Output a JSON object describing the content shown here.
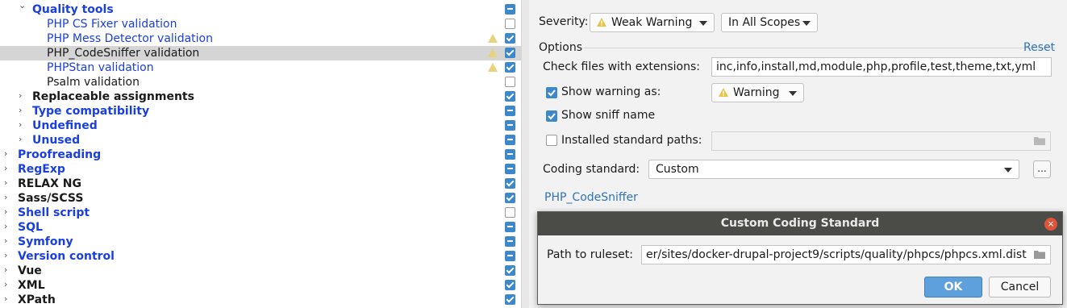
{
  "tree": {
    "items": [
      {
        "label": "Quality tools",
        "indent": 1,
        "expanded": true,
        "bold": true,
        "color": "blue",
        "check": "mixed",
        "warn": false,
        "selected": false
      },
      {
        "label": "PHP CS Fixer validation",
        "indent": 2,
        "leaf": true,
        "bold": false,
        "color": "blue",
        "check": "off",
        "warn": false,
        "selected": false
      },
      {
        "label": "PHP Mess Detector validation",
        "indent": 2,
        "leaf": true,
        "bold": false,
        "color": "blue",
        "check": "on",
        "warn": true,
        "selected": false
      },
      {
        "label": "PHP_CodeSniffer validation",
        "indent": 2,
        "leaf": true,
        "bold": false,
        "color": "black",
        "check": "on",
        "warn": true,
        "selected": true
      },
      {
        "label": "PHPStan validation",
        "indent": 2,
        "leaf": true,
        "bold": false,
        "color": "blue",
        "check": "on",
        "warn": true,
        "selected": false
      },
      {
        "label": "Psalm validation",
        "indent": 2,
        "leaf": true,
        "bold": false,
        "color": "black",
        "check": "off",
        "warn": false,
        "selected": false
      },
      {
        "label": "Replaceable assignments",
        "indent": 1,
        "expanded": false,
        "bold": true,
        "color": "black",
        "check": "on",
        "warn": false,
        "selected": false
      },
      {
        "label": "Type compatibility",
        "indent": 1,
        "expanded": false,
        "bold": true,
        "color": "blue",
        "check": "mixed",
        "warn": false,
        "selected": false
      },
      {
        "label": "Undefined",
        "indent": 1,
        "expanded": false,
        "bold": true,
        "color": "blue",
        "check": "mixed",
        "warn": false,
        "selected": false
      },
      {
        "label": "Unused",
        "indent": 1,
        "expanded": false,
        "bold": true,
        "color": "blue",
        "check": "mixed",
        "warn": false,
        "selected": false
      },
      {
        "label": "Proofreading",
        "indent": 0,
        "expanded": false,
        "bold": true,
        "color": "blue",
        "check": "mixed",
        "warn": false,
        "selected": false
      },
      {
        "label": "RegExp",
        "indent": 0,
        "expanded": false,
        "bold": true,
        "color": "blue",
        "check": "mixed",
        "warn": false,
        "selected": false
      },
      {
        "label": "RELAX NG",
        "indent": 0,
        "expanded": false,
        "bold": true,
        "color": "black",
        "check": "on",
        "warn": false,
        "selected": false
      },
      {
        "label": "Sass/SCSS",
        "indent": 0,
        "expanded": false,
        "bold": true,
        "color": "black",
        "check": "on",
        "warn": false,
        "selected": false
      },
      {
        "label": "Shell script",
        "indent": 0,
        "expanded": false,
        "bold": true,
        "color": "blue",
        "check": "off",
        "warn": false,
        "selected": false
      },
      {
        "label": "SQL",
        "indent": 0,
        "expanded": false,
        "bold": true,
        "color": "blue",
        "check": "mixed",
        "warn": false,
        "selected": false
      },
      {
        "label": "Symfony",
        "indent": 0,
        "expanded": false,
        "bold": true,
        "color": "blue",
        "check": "mixed",
        "warn": false,
        "selected": false
      },
      {
        "label": "Version control",
        "indent": 0,
        "expanded": false,
        "bold": true,
        "color": "blue",
        "check": "mixed",
        "warn": false,
        "selected": false
      },
      {
        "label": "Vue",
        "indent": 0,
        "expanded": false,
        "bold": true,
        "color": "black",
        "check": "on",
        "warn": false,
        "selected": false
      },
      {
        "label": "XML",
        "indent": 0,
        "expanded": false,
        "bold": true,
        "color": "black",
        "check": "on",
        "warn": false,
        "selected": false
      },
      {
        "label": "XPath",
        "indent": 0,
        "expanded": false,
        "bold": true,
        "color": "black",
        "check": "on",
        "warn": false,
        "selected": false
      }
    ]
  },
  "settings": {
    "severity_label": "Severity:",
    "severity_value": "Weak Warning",
    "scope_value": "In All Scopes",
    "options_label": "Options",
    "reset_label": "Reset",
    "check_ext_label": "Check files with extensions:",
    "check_ext_value": "inc,info,install,md,module,php,profile,test,theme,txt,yml",
    "show_warning_label": "Show warning as:",
    "show_warning_value": "Warning",
    "show_sniff_label": "Show sniff name",
    "installed_paths_label": "Installed standard paths:",
    "installed_paths_value": "",
    "coding_standard_label": "Coding standard:",
    "coding_standard_value": "Custom",
    "more_button_label": "...",
    "link_label": "PHP_CodeSniffer"
  },
  "dialog": {
    "title": "Custom Coding Standard",
    "close_label": "×",
    "path_label": "Path to ruleset:",
    "path_value": "er/sites/docker-drupal-project9/scripts/quality/phpcs/phpcs.xml.dist",
    "ok_label": "OK",
    "cancel_label": "Cancel"
  },
  "colors": {
    "accent": "#3d88c8",
    "link": "#2f73b8",
    "tree_blue": "#1a3fe0",
    "warning_icon": "#e8c34a",
    "dialog_title_bg": "#4b4b47",
    "close_button": "#e0543a",
    "ok_button": "#5ea0dc"
  },
  "icons": {
    "expanded": "chevron-down-icon",
    "collapsed": "chevron-right-icon",
    "warning": "warning-triangle-icon",
    "folder": "folder-icon",
    "dropdown": "dropdown-arrow-icon"
  }
}
